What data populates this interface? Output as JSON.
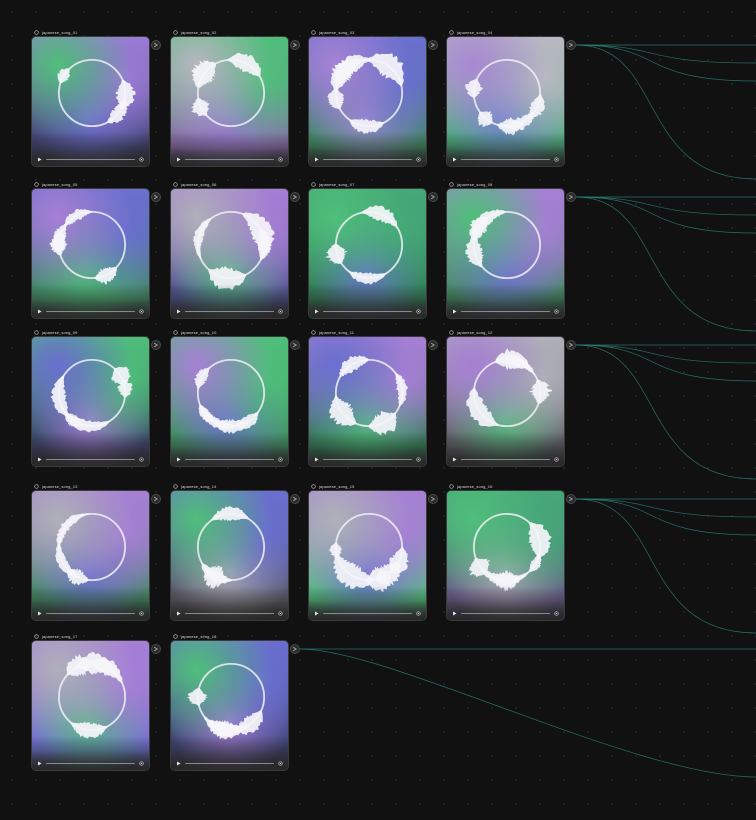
{
  "window_title": "",
  "accent_color": "#2f8f85",
  "nodes": [
    {
      "label": "japanese_song_01",
      "palette": [
        "#4fbf7a",
        "#9a7bd6",
        "#6d6fd0",
        "#3a3f6a"
      ]
    },
    {
      "label": "japanese_song_02",
      "palette": [
        "#b7b7c0",
        "#4fbf7a",
        "#9a7bd6",
        "#8a6aa8"
      ]
    },
    {
      "label": "japanese_song_03",
      "palette": [
        "#a782d6",
        "#6a6fd0",
        "#9a8ad0",
        "#3f8a5e"
      ]
    },
    {
      "label": "japanese_song_04",
      "palette": [
        "#a988d4",
        "#b9b9c2",
        "#6d7fd0",
        "#45a878"
      ]
    },
    {
      "label": "japanese_song_05",
      "palette": [
        "#a77fd6",
        "#6a6fd0",
        "#4fbf7a",
        "#3f8a5e"
      ]
    },
    {
      "label": "japanese_song_06",
      "palette": [
        "#b0b0ba",
        "#a77fd6",
        "#4fbf7a",
        "#4a4f8a"
      ]
    },
    {
      "label": "japanese_song_07",
      "palette": [
        "#4fbf7a",
        "#45a878",
        "#6a6fd0",
        "#2f7a52"
      ]
    },
    {
      "label": "japanese_song_08",
      "palette": [
        "#4fbf7a",
        "#a77fd6",
        "#6a6fd0",
        "#3f8a5e"
      ]
    },
    {
      "label": "japanese_song_09",
      "palette": [
        "#6a6fd0",
        "#4fbf7a",
        "#a77fd6",
        "#3a3f6a"
      ]
    },
    {
      "label": "japanese_song_10",
      "palette": [
        "#a77fd6",
        "#4fbf7a",
        "#6a6fd0",
        "#3f8a5e"
      ]
    },
    {
      "label": "japanese_song_11",
      "palette": [
        "#6a6fd0",
        "#a77fd6",
        "#4fbf7a",
        "#2f7a52"
      ]
    },
    {
      "label": "japanese_song_12",
      "palette": [
        "#a77fd6",
        "#b0b0ba",
        "#4fbf7a",
        "#5a5a62"
      ]
    },
    {
      "label": "japanese_song_13",
      "palette": [
        "#b0b0ba",
        "#a77fd6",
        "#6a6fd0",
        "#3f8a5e"
      ]
    },
    {
      "label": "japanese_song_14",
      "palette": [
        "#4fbf7a",
        "#6a6fd0",
        "#b0b0ba",
        "#5a5a62"
      ]
    },
    {
      "label": "japanese_song_15",
      "palette": [
        "#b0b0ba",
        "#a77fd6",
        "#6a6fd0",
        "#4fbf7a"
      ]
    },
    {
      "label": "japanese_song_16",
      "palette": [
        "#4fbf7a",
        "#45a878",
        "#b0b0ba",
        "#6a5a8a"
      ]
    },
    {
      "label": "japanese_song_17",
      "palette": [
        "#b0b0ba",
        "#a77fd6",
        "#4fbf7a",
        "#6a6fd0"
      ]
    },
    {
      "label": "japanese_song_18",
      "palette": [
        "#4fbf7a",
        "#6a6fd0",
        "#a77fd6",
        "#3a3f6a"
      ]
    }
  ]
}
